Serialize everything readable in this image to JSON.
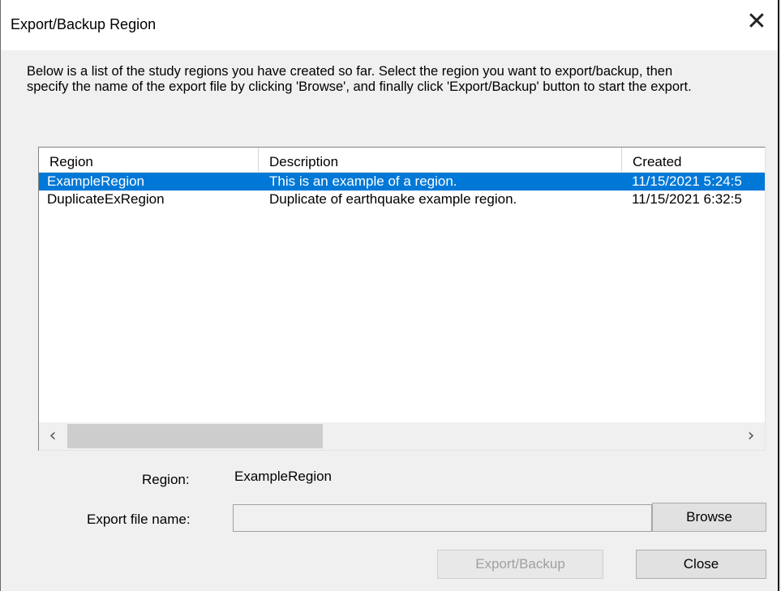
{
  "window": {
    "title": "Export/Backup Region",
    "close_glyph": "✕"
  },
  "instructions": "Below is a list of the study regions you have created so far.  Select the region you want to export/backup, then specify the name of the export file by clicking 'Browse', and finally click 'Export/Backup' button to start the export.",
  "list": {
    "columns": [
      "Region",
      "Description",
      "Created"
    ],
    "rows": [
      {
        "region": "ExampleRegion",
        "description": "This is an example of a region.",
        "created": "11/15/2021 5:24:5",
        "selected": true
      },
      {
        "region": "DuplicateExRegion",
        "description": "Duplicate of earthquake example region.",
        "created": "11/15/2021 6:32:5",
        "selected": false
      }
    ],
    "scroll_left_glyph": "‹",
    "scroll_right_glyph": "›"
  },
  "form": {
    "region_label": "Region:",
    "region_value": "ExampleRegion",
    "export_file_label": "Export file name:",
    "export_file_value": ""
  },
  "buttons": {
    "browse": "Browse",
    "export": "Export/Backup",
    "close": "Close"
  },
  "colors": {
    "selection": "#0078d7",
    "window_bg": "#f0f0f0"
  }
}
